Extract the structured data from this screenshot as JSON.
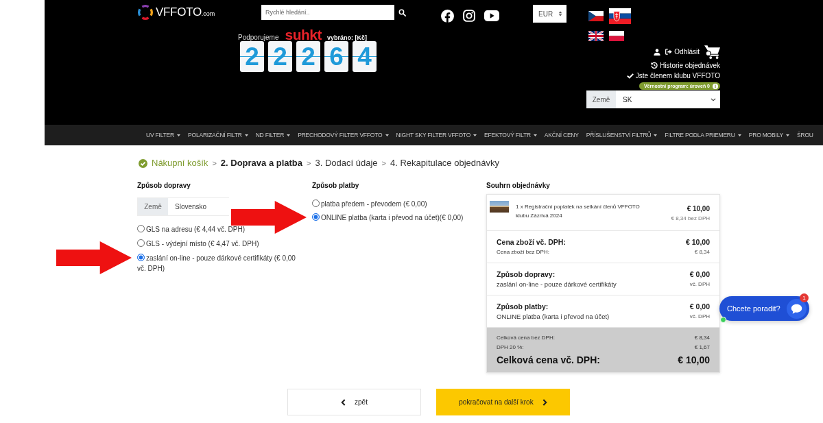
{
  "header": {
    "logo": {
      "name": "VFFOTO",
      "suffix": ".com"
    },
    "search": {
      "placeholder": "Rychlé hledání.."
    },
    "fundraiser": {
      "intro": "Podporujeme",
      "partner": "suhkt",
      "label": "vybráno: [Kč]",
      "digits": [
        "2",
        "2",
        "2",
        "6",
        "4"
      ]
    },
    "social": [
      {
        "kind": "facebook"
      },
      {
        "kind": "instagram"
      },
      {
        "kind": "youtube"
      }
    ],
    "currency": {
      "value": "EUR"
    },
    "languages": [
      {
        "kind": "cz",
        "selected": false
      },
      {
        "kind": "sk",
        "selected": true
      },
      {
        "kind": "gb",
        "selected": false
      },
      {
        "kind": "pl",
        "selected": false
      }
    ],
    "account": {
      "logout": "Odhlásit",
      "history": "Historie objednávek",
      "membership": "Jste členem klubu VFFOTO",
      "loyalty": "Věrnostní program: úroveň 0"
    },
    "country": {
      "label": "Země",
      "value": "SK"
    }
  },
  "nav": [
    {
      "label": "UV FILTER",
      "has_menu": true
    },
    {
      "label": "POLARIZAČNÍ FILTR",
      "has_menu": true
    },
    {
      "label": "ND FILTER",
      "has_menu": true
    },
    {
      "label": "PRECHODOVÝ FILTER VFFOTO",
      "has_menu": true
    },
    {
      "label": "NIGHT SKY FILTER VFFOTO",
      "has_menu": true
    },
    {
      "label": "EFEKTOVÝ FILTR",
      "has_menu": true
    },
    {
      "label": "AKČNÍ CENY",
      "has_menu": false
    },
    {
      "label": "PŘÍSLUŠENSTVÍ FILTRŮ",
      "has_menu": true
    },
    {
      "label": "FILTRE PODLA PRIEMERU",
      "has_menu": true
    },
    {
      "label": "PRO MOBILY",
      "has_menu": true
    },
    {
      "label": "ŠROU",
      "has_menu": false
    }
  ],
  "steps": [
    {
      "label": "Nákupní košík",
      "done": true,
      "selected": false
    },
    {
      "label": "2. Doprava a platba",
      "done": false,
      "selected": true
    },
    {
      "label": "3. Dodací údaje",
      "done": false,
      "selected": false
    },
    {
      "label": "4. Rekapitulace objednávky",
      "done": false,
      "selected": false
    }
  ],
  "step_separators": [
    ">",
    ">",
    ">"
  ],
  "shipping": {
    "title": "Způsob dopravy",
    "country": {
      "label": "Země",
      "value": "Slovensko"
    },
    "options": [
      {
        "label": "GLS na adresu (€ 4,44 vč. DPH)",
        "selected": false,
        "pointed_at": false
      },
      {
        "label": "GLS - výdejní místo (€ 4,47 vč. DPH)",
        "selected": false,
        "pointed_at": false
      },
      {
        "label": "zaslání on-line - pouze dárkové certifikáty (€ 0,00 vč. DPH)",
        "selected": true,
        "pointed_at": true
      }
    ]
  },
  "payment": {
    "title": "Způsob platby",
    "options": [
      {
        "label": "platba předem - převodem (€ 0,00)",
        "selected": false,
        "pointed_at": false
      },
      {
        "label": "ONLINE platba (karta i převod na účet)(€ 0,00)",
        "selected": true,
        "pointed_at": true
      }
    ]
  },
  "summary": {
    "title": "Souhrn objednávky",
    "items": [
      {
        "name": "1 x Registrační poplatek na setkání členů VFFOTO klubu Zázrivá 2024",
        "price": "€ 10,00",
        "price_net": "€ 8,34 bez DPH"
      }
    ],
    "lines": [
      {
        "kind": "price",
        "label": "Cena zboží vč. DPH:",
        "value": "€ 10,00",
        "sub_label": "Cena zboží bez DPH:",
        "sub_value": "€ 8,34"
      },
      {
        "kind": "method",
        "label": "Způsob dopravy:",
        "value": "€ 0,00",
        "sub_label": "zaslání on-line - pouze dárkové certifikáty",
        "sub_value": "vč. DPH"
      },
      {
        "kind": "method",
        "label": "Způsob platby:",
        "value": "€ 0,00",
        "sub_label": "ONLINE platba (karta i převod na účet)",
        "sub_value": "vč. DPH"
      }
    ],
    "totals": [
      {
        "kind": "minor",
        "label": "Celková cena bez DPH:",
        "value": "€ 8,34"
      },
      {
        "kind": "minor",
        "label": "DPH 20 %:",
        "value": "€ 1,67"
      },
      {
        "kind": "grand",
        "label": "Celková cena vč. DPH:",
        "value": "€ 10,00"
      }
    ]
  },
  "actions": {
    "back": "zpět",
    "next": "pokračovat na další krok"
  },
  "chat": {
    "label": "Chcete poradit?",
    "badge": "1",
    "online": true
  }
}
